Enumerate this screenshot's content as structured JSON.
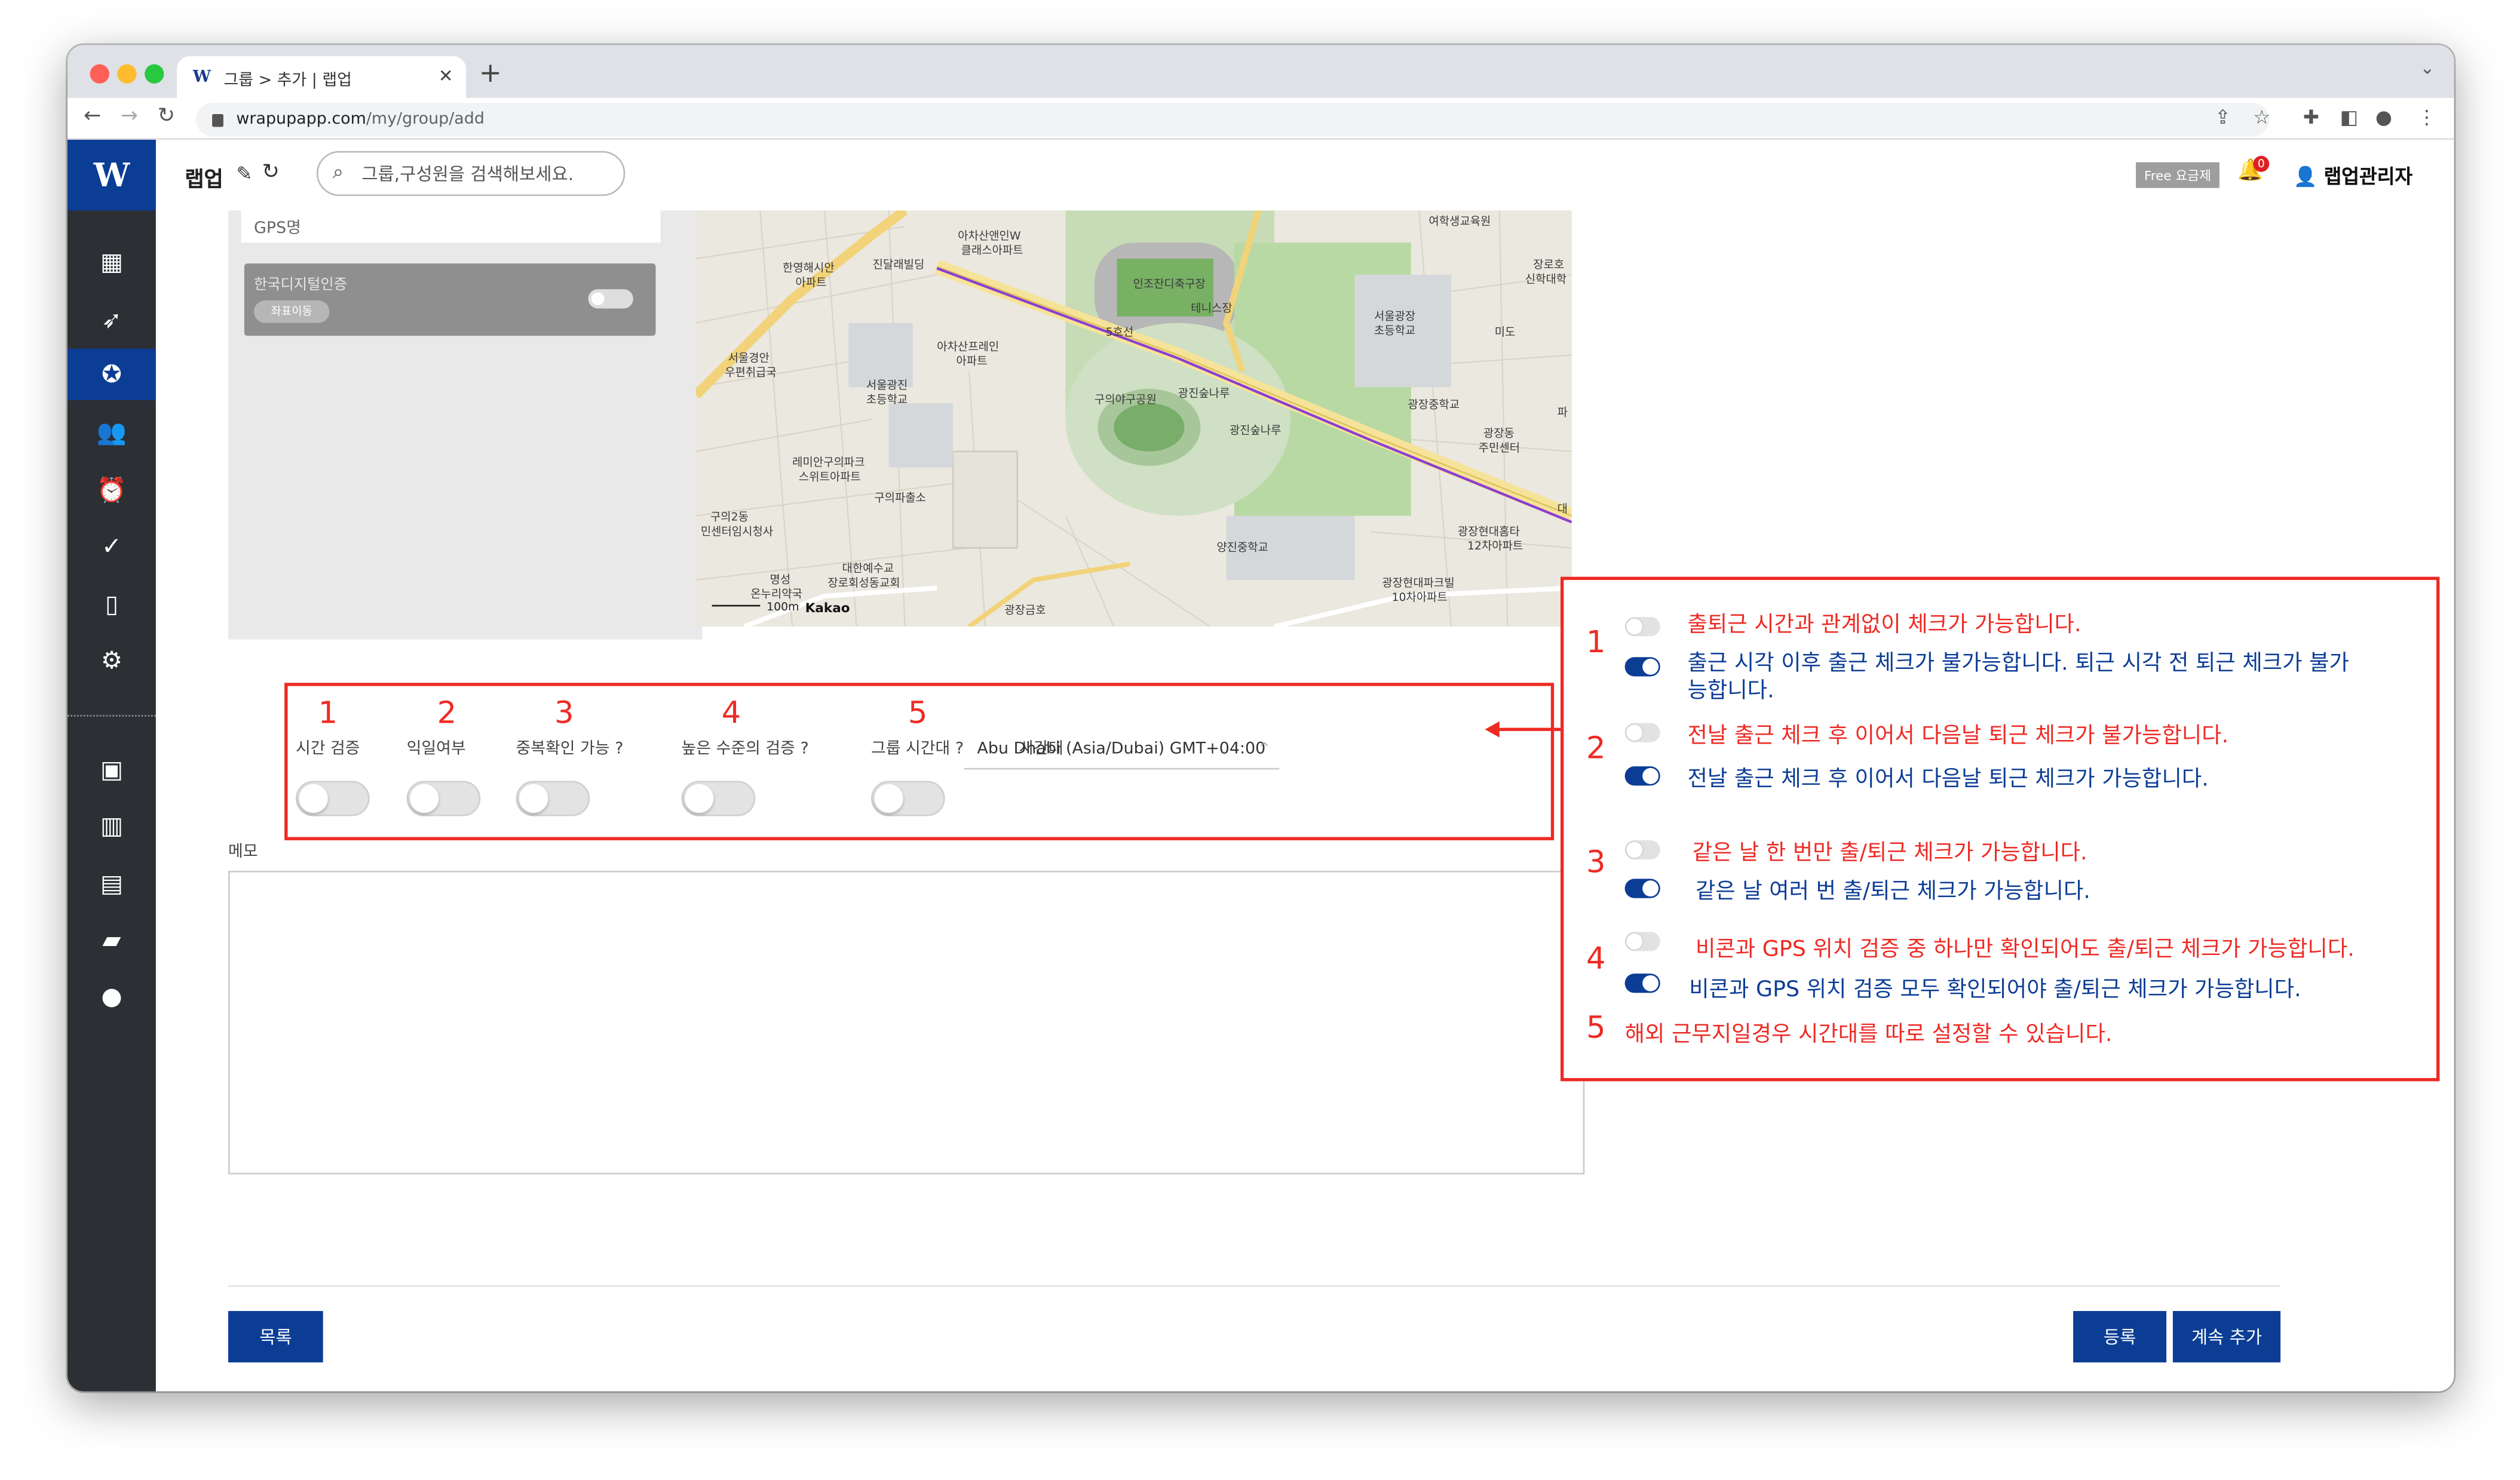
{
  "browser": {
    "tab_title": "그룹 > 추가 | 랩업",
    "tab_favicon": "W",
    "new_tab": "+",
    "url_domain": "wrapupapp.com",
    "url_path": "/my/group/add"
  },
  "sidebar": {
    "logo": "W",
    "icons": [
      "dashboard-icon",
      "rocket-icon",
      "group-icon",
      "people-icon",
      "alarm-icon",
      "check-icon",
      "phone-icon",
      "gear-icon",
      "contact-card-icon",
      "building-icon",
      "store-icon",
      "chat-icon",
      "support-icon"
    ],
    "active_index": 2
  },
  "header": {
    "brand": "랩업",
    "search_placeholder": "그룹,구성원을 검색해보세요.",
    "plan_badge": "Free 요금제",
    "notification_count": "0",
    "user_name": "랩업관리자"
  },
  "gps": {
    "name_label": "GPS명",
    "card_title": "한국디지털인증",
    "card_button": "좌표이동"
  },
  "map": {
    "labels": [
      "여학생교육원",
      "아차산앤인W",
      "클래스아파트",
      "한영해시안",
      "아파트",
      "진달래빌딩",
      "인조잔디축구장",
      "테니스장",
      "5호선",
      "서울광장",
      "초등학교",
      "장로호",
      "신학대학",
      "서울경안",
      "우편취급국",
      "아차산프레인",
      "아파트",
      "서울광진",
      "초등학교",
      "구의야구공원",
      "광진숲나루",
      "미도",
      "광장중학교",
      "광진숲나루",
      "광장동",
      "주민센터",
      "레미안구의파크",
      "스위트아파트",
      "구의파출소",
      "구의2동",
      "민센터임시청사",
      "광장현대홈타",
      "12차아파트",
      "대",
      "명성",
      "온누리약국",
      "대한예수교",
      "장로회성동교회",
      "양진중학교",
      "광장현대파크빌",
      "10차아파트",
      "광장금호",
      "파"
    ],
    "scale": "100m",
    "provider": "Kakao"
  },
  "options": {
    "numbers": [
      "1",
      "2",
      "3",
      "4",
      "5"
    ],
    "labels": [
      "시간 검증",
      "익일여부",
      "중복확인 가능",
      "높은 수준의 검증",
      "그룹 시간대"
    ],
    "timezone_label": "시간대",
    "timezone_value": "Abu Dhabi (Asia/Dubai) GMT+04:00"
  },
  "memo": {
    "label": "메모",
    "value": ""
  },
  "buttons": {
    "list": "목록",
    "register": "등록",
    "continue_add": "계속 추가"
  },
  "callout": {
    "items": [
      {
        "num": "1",
        "off": "출퇴근 시간과 관계없이 체크가 가능합니다.",
        "on": "출근 시각 이후 출근 체크가 불가능합니다. 퇴근 시각 전 퇴근 체크가 불가",
        "on2": "능합니다."
      },
      {
        "num": "2",
        "off": "전날 출근 체크 후 이어서 다음날 퇴근 체크가 불가능합니다.",
        "on": "전날 출근 체크 후 이어서 다음날 퇴근 체크가 가능합니다."
      },
      {
        "num": "3",
        "off": "같은 날 한 번만 출/퇴근 체크가 가능합니다.",
        "on": "같은 날 여러 번 출/퇴근 체크가 가능합니다."
      },
      {
        "num": "4",
        "off": "비콘과 GPS 위치 검증 중 하나만 확인되어도 출/퇴근 체크가 가능합니다.",
        "on": "비콘과 GPS 위치 검증 모두 확인되어야 출/퇴근 체크가 가능합니다."
      },
      {
        "num": "5",
        "text": "해외 근무지일경우 시간대를 따로 설정할 수 있습니다."
      }
    ],
    "colors": {
      "annotation": "#ee2a24",
      "brand": "#0c3d95"
    }
  }
}
